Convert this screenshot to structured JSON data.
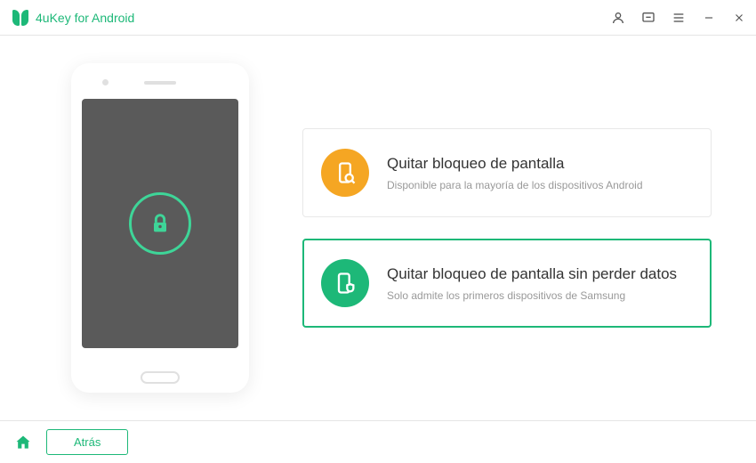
{
  "titlebar": {
    "app_name": "4uKey for Android"
  },
  "options": {
    "remove_lock": {
      "title": "Quitar bloqueo de pantalla",
      "description": "Disponible para la mayoría de los dispositivos Android"
    },
    "remove_lock_nodata": {
      "title": "Quitar bloqueo de pantalla sin perder datos",
      "description": "Solo admite los primeros dispositivos de Samsung"
    }
  },
  "footer": {
    "back_label": "Atrás"
  },
  "colors": {
    "brand": "#1db878",
    "accent_orange": "#f5a623"
  }
}
